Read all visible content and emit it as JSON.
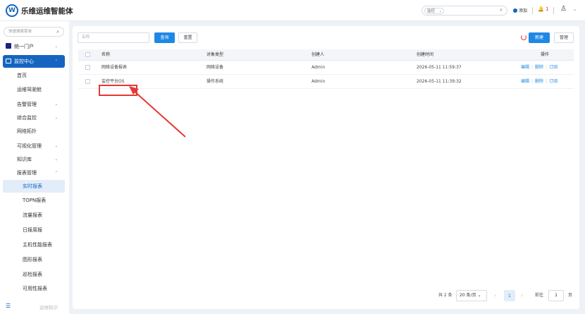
{
  "header": {
    "title": "乐维运维智能体",
    "scope_select": "监控",
    "add_label": "添加",
    "alert_count": "1"
  },
  "sidebar": {
    "search_placeholder": "快速搜索菜单",
    "items": [
      {
        "label": "统一门户"
      },
      {
        "label": "监控中心"
      },
      {
        "label": "首页"
      },
      {
        "label": "运维驾驶舱"
      },
      {
        "label": "告警管理"
      },
      {
        "label": "综合监控"
      },
      {
        "label": "网络拓扑"
      },
      {
        "label": "可视化管理"
      },
      {
        "label": "知识库"
      },
      {
        "label": "报表管理"
      },
      {
        "label": "实时报表"
      },
      {
        "label": "TOPN报表"
      },
      {
        "label": "流量报表"
      },
      {
        "label": "日报周报"
      },
      {
        "label": "主机性能报表"
      },
      {
        "label": "图形报表"
      },
      {
        "label": "巡检报表"
      },
      {
        "label": "可用性报表"
      }
    ],
    "footer_link": "运维知识"
  },
  "toolbar": {
    "name_placeholder": "名称",
    "query_label": "查询",
    "reset_label": "重置",
    "new_label": "新建",
    "manage_label": "管理"
  },
  "table": {
    "columns": [
      "名称",
      "对象类型",
      "创建人",
      "创建时间",
      "操作"
    ],
    "rows": [
      {
        "name": "网络设备报表",
        "type": "网络设备",
        "creator": "Admin",
        "created": "2026-05-11 11:59:37"
      },
      {
        "name": "监控平台OS",
        "type": "操作系统",
        "creator": "Admin",
        "created": "2026-05-11 11:39:32"
      }
    ],
    "actions": [
      "编辑",
      "删除",
      "订阅"
    ]
  },
  "pagination": {
    "total": "共 2 条",
    "page_size": "20 条/页",
    "current": "1",
    "goto_label": "前往",
    "goto_value": "1",
    "page_suffix": "页"
  }
}
